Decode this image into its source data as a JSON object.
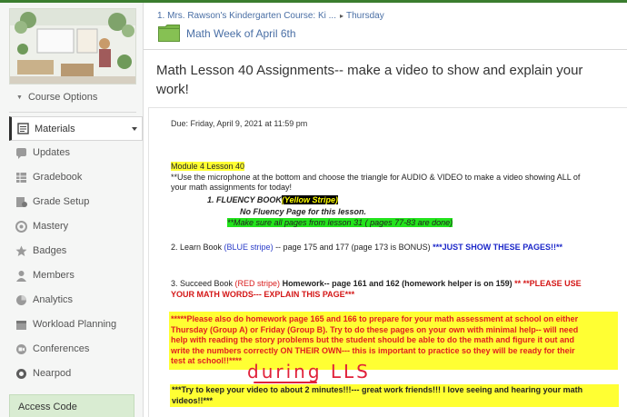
{
  "sidebar": {
    "course_options": "Course Options",
    "materials": "Materials",
    "items": [
      {
        "label": "Updates",
        "icon": "updates-icon"
      },
      {
        "label": "Gradebook",
        "icon": "gradebook-icon"
      },
      {
        "label": "Grade Setup",
        "icon": "grade-setup-icon"
      },
      {
        "label": "Mastery",
        "icon": "mastery-icon"
      },
      {
        "label": "Badges",
        "icon": "badges-icon"
      },
      {
        "label": "Members",
        "icon": "members-icon"
      },
      {
        "label": "Analytics",
        "icon": "analytics-icon"
      },
      {
        "label": "Workload Planning",
        "icon": "workload-planning-icon"
      },
      {
        "label": "Conferences",
        "icon": "conferences-icon"
      },
      {
        "label": "Nearpod",
        "icon": "nearpod-icon"
      }
    ],
    "access_code": "Access Code"
  },
  "header": {
    "breadcrumb_course": "1. Mrs. Rawson's Kindergarten Course: Ki ...",
    "breadcrumb_arrow": "▸",
    "breadcrumb_folder": "Thursday",
    "folder_title": "Math Week of April 6th",
    "page_title": "Math Lesson 40 Assignments-- make a video to show and explain your work!"
  },
  "assignment": {
    "due": "Due: Friday, April 9, 2021 at 11:59 pm",
    "module": "Module 4  Lesson 40",
    "intro_1": "**Use the microphone at the bottom and choose the triangle for AUDIO & VIDEO to make a video showing ALL of",
    "intro_2": "your math assignments for today!",
    "fluency_prefix": "1.  FLUENCY BOOK",
    "fluency_stripe": "(Yellow Stripe)",
    "fluency_note": "No Fluency Page for this lesson.",
    "fluency_check": "**Make sure all pages from lesson 31 ( pages 77-83 are done)",
    "learn_prefix": "2.  Learn Book ",
    "learn_stripe": "(BLUE stripe)",
    "learn_pages": " -- page 175 and 177 (page 173 is BONUS) ",
    "learn_note": "***JUST SHOW THESE PAGES!!**",
    "succeed_prefix": "3. Succeed Book ",
    "succeed_stripe": "(RED stripe)",
    "succeed_pages": " Homework-- page 161 and 162  (homework helper is on 159) ",
    "succeed_note_1": "** **PLEASE USE",
    "succeed_note_2": "YOUR MATH WORDS--- EXPLAIN THIS PAGE***",
    "homework_1": "*****Please also do homework page 165 and 166 to prepare for your math assessment at school on either",
    "homework_2": "Thursday (Group A) or Friday (Group B).  Try to do these pages on your own with minimal help-- will need",
    "homework_3": "help with reading the story problems but the student should be able to do the math and figure it out and",
    "homework_4": "write the numbers correctly ON THEIR OWN--- this is important to practice so they will be ready for their",
    "homework_5": "test at school!!****",
    "handwritten": "during LLS",
    "closing_1": "***Try to keep your video to about 2 minutes!!!--- great work friends!!!  I love seeing and hearing your math",
    "closing_2": "videos!!***"
  },
  "colors": {
    "accent_green": "#3a7d2f",
    "link_blue": "#4a6fa5",
    "highlight_yellow": "#ffff33",
    "highlight_green": "#22e31c",
    "text_red": "#d41717",
    "text_blue": "#1b27c9",
    "access_code_bg": "#d9ecd2"
  }
}
